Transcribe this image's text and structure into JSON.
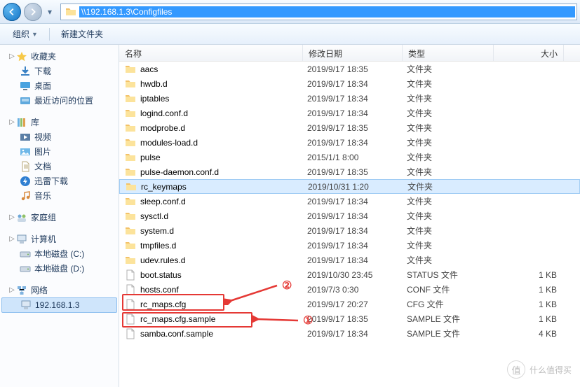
{
  "address": {
    "path": "\\\\192.168.1.3\\Configfiles"
  },
  "toolbar": {
    "organize": "组织",
    "new_folder": "新建文件夹"
  },
  "sidebar": {
    "favorites": {
      "label": "收藏夹",
      "items": [
        {
          "label": "下载",
          "icon": "download"
        },
        {
          "label": "桌面",
          "icon": "desktop"
        },
        {
          "label": "最近访问的位置",
          "icon": "recent"
        }
      ]
    },
    "libraries": {
      "label": "库",
      "items": [
        {
          "label": "视频",
          "icon": "video"
        },
        {
          "label": "图片",
          "icon": "picture"
        },
        {
          "label": "文档",
          "icon": "document"
        },
        {
          "label": "迅雷下载",
          "icon": "xunlei"
        },
        {
          "label": "音乐",
          "icon": "music"
        }
      ]
    },
    "homegroup": {
      "label": "家庭组"
    },
    "computer": {
      "label": "计算机",
      "items": [
        {
          "label": "本地磁盘 (C:)",
          "icon": "drive"
        },
        {
          "label": "本地磁盘 (D:)",
          "icon": "drive"
        }
      ]
    },
    "network": {
      "label": "网络",
      "items": [
        {
          "label": "192.168.1.3",
          "icon": "computer",
          "selected": true
        }
      ]
    }
  },
  "columns": {
    "name": "名称",
    "date": "修改日期",
    "type": "类型",
    "size": "大小"
  },
  "type_labels": {
    "folder": "文件夹",
    "status": "STATUS 文件",
    "conf": "CONF 文件",
    "cfg": "CFG 文件",
    "sample": "SAMPLE 文件"
  },
  "files": [
    {
      "name": "aacs",
      "date": "2019/9/17 18:35",
      "type": "folder",
      "size": ""
    },
    {
      "name": "hwdb.d",
      "date": "2019/9/17 18:34",
      "type": "folder",
      "size": ""
    },
    {
      "name": "iptables",
      "date": "2019/9/17 18:34",
      "type": "folder",
      "size": ""
    },
    {
      "name": "logind.conf.d",
      "date": "2019/9/17 18:34",
      "type": "folder",
      "size": ""
    },
    {
      "name": "modprobe.d",
      "date": "2019/9/17 18:35",
      "type": "folder",
      "size": ""
    },
    {
      "name": "modules-load.d",
      "date": "2019/9/17 18:34",
      "type": "folder",
      "size": ""
    },
    {
      "name": "pulse",
      "date": "2015/1/1 8:00",
      "type": "folder",
      "size": ""
    },
    {
      "name": "pulse-daemon.conf.d",
      "date": "2019/9/17 18:35",
      "type": "folder",
      "size": ""
    },
    {
      "name": "rc_keymaps",
      "date": "2019/10/31 1:20",
      "type": "folder",
      "size": "",
      "selected": true
    },
    {
      "name": "sleep.conf.d",
      "date": "2019/9/17 18:34",
      "type": "folder",
      "size": ""
    },
    {
      "name": "sysctl.d",
      "date": "2019/9/17 18:34",
      "type": "folder",
      "size": ""
    },
    {
      "name": "system.d",
      "date": "2019/9/17 18:34",
      "type": "folder",
      "size": ""
    },
    {
      "name": "tmpfiles.d",
      "date": "2019/9/17 18:34",
      "type": "folder",
      "size": ""
    },
    {
      "name": "udev.rules.d",
      "date": "2019/9/17 18:34",
      "type": "folder",
      "size": ""
    },
    {
      "name": "boot.status",
      "date": "2019/10/30 23:45",
      "type": "status",
      "size": "1 KB"
    },
    {
      "name": "hosts.conf",
      "date": "2019/7/3 0:30",
      "type": "conf",
      "size": "1 KB"
    },
    {
      "name": "rc_maps.cfg",
      "date": "2019/9/17 20:27",
      "type": "cfg",
      "size": "1 KB",
      "annot": 2
    },
    {
      "name": "rc_maps.cfg.sample",
      "date": "2019/9/17 18:35",
      "type": "sample",
      "size": "1 KB",
      "annot": 1
    },
    {
      "name": "samba.conf.sample",
      "date": "2019/9/17 18:34",
      "type": "sample",
      "size": "4 KB"
    }
  ],
  "annotations": {
    "label1": "①",
    "label2": "②"
  },
  "watermark": {
    "char": "值",
    "text": "什么值得买"
  }
}
